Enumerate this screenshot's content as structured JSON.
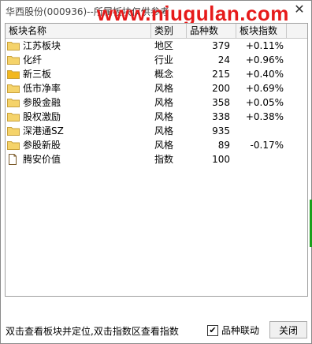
{
  "window": {
    "title": "华西股份(000936)--所属板块仅供参考",
    "watermark": "www.niugulan.com",
    "close_glyph": "✕"
  },
  "table": {
    "headers": {
      "name": "板块名称",
      "type": "类别",
      "count": "品种数",
      "pct": "板块指数"
    },
    "rows": [
      {
        "name": "江苏板块",
        "type": "地区",
        "count": "379",
        "pct": "+0.11%",
        "icon": "folder-icon"
      },
      {
        "name": "化纤",
        "type": "行业",
        "count": "24",
        "pct": "+0.96%",
        "icon": "folder-icon"
      },
      {
        "name": "新三板",
        "type": "概念",
        "count": "215",
        "pct": "+0.40%",
        "icon": "folder-icon-filled"
      },
      {
        "name": "低市净率",
        "type": "风格",
        "count": "200",
        "pct": "+0.69%",
        "icon": "folder-icon"
      },
      {
        "name": "参股金融",
        "type": "风格",
        "count": "358",
        "pct": "+0.05%",
        "icon": "folder-icon"
      },
      {
        "name": "股权激励",
        "type": "风格",
        "count": "338",
        "pct": "+0.38%",
        "icon": "folder-icon"
      },
      {
        "name": "深港通SZ",
        "type": "风格",
        "count": "935",
        "pct": "",
        "icon": "folder-icon"
      },
      {
        "name": "参股新股",
        "type": "风格",
        "count": "89",
        "pct": "-0.17%",
        "icon": "folder-icon"
      },
      {
        "name": "腾安价值",
        "type": "指数",
        "count": "100",
        "pct": "",
        "icon": "document-icon"
      }
    ]
  },
  "footer": {
    "hint": "双击查看板块并定位,双击指数区查看指数",
    "checkbox_label": "品种联动",
    "checkbox_checked": "✔",
    "close_button": "关闭"
  },
  "colors": {
    "folder": "#f5d36a",
    "folder_outline": "#c9a13a",
    "folder_filled": "#f2b81e",
    "watermark": "#e61a1a"
  }
}
